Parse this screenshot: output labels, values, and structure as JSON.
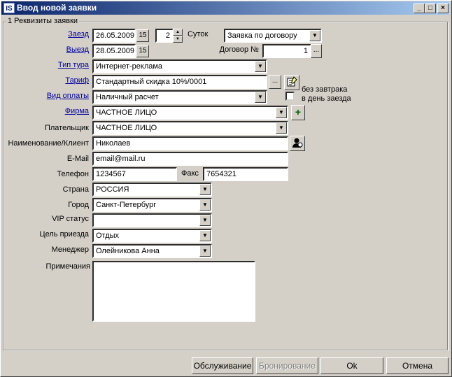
{
  "window": {
    "title": "Ввод новой заявки",
    "icon": "IS",
    "min_label": "_",
    "max_label": "□",
    "close_label": "×"
  },
  "group": {
    "label": "1 Реквизиты заявки"
  },
  "labels": {
    "arrival": "Заезд",
    "departure": "Выезд",
    "nights": "Суток",
    "contract_no": "Договор №",
    "tour_type": "Тип тура",
    "tariff": "Тариф",
    "payment_type": "Вид оплаты",
    "firm": "Фирма",
    "payer": "Плательщик",
    "name_client": "Наименование/Клиент",
    "email": "E-Mail",
    "phone": "Телефон",
    "fax": "Факс",
    "country": "Страна",
    "city": "Город",
    "vip": "VIP статус",
    "purpose": "Цель приезда",
    "manager": "Менеджер",
    "notes": "Примечания",
    "no_breakfast_1": "без завтрака",
    "no_breakfast_2": "в день заезда"
  },
  "values": {
    "arrival": "26.05.2009",
    "departure": "28.05.2009",
    "nights": "2",
    "order_type": "Заявка по договору",
    "contract_no": "1",
    "tour_type": "Интернет-реклама",
    "tariff": "Стандартный скидка 10%/0001",
    "payment_type": "Наличный расчет",
    "firm": "ЧАСТНОЕ ЛИЦО",
    "payer": "ЧАСТНОЕ ЛИЦО",
    "name_client": "Николаев",
    "email": "email@mail.ru",
    "phone": "1234567",
    "fax": "7654321",
    "country": "РОССИЯ",
    "city": "Санкт-Петербург",
    "vip": "",
    "purpose": "Отдых",
    "manager": "Олейникова Анна",
    "notes": ""
  },
  "buttons": {
    "service": "Обслуживание",
    "booking": "Бронирование",
    "ok": "Ok",
    "cancel": "Отмена",
    "calendar_glyph": "15",
    "ellipsis": "...",
    "plus": "+",
    "combo_arrow": "▼",
    "spin_up": "▲",
    "spin_down": "▼"
  },
  "icons": {
    "calendar": "calendar-icon",
    "tariff_edit": "tariff-edit-icon",
    "add_firm": "plus-icon",
    "client_lookup": "client-lookup-icon"
  }
}
